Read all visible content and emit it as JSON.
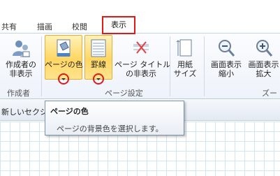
{
  "tabs": [
    {
      "label": "共有"
    },
    {
      "label": "描画"
    },
    {
      "label": "校閲"
    }
  ],
  "active_tab": {
    "label": "表示"
  },
  "ribbon": {
    "author": {
      "button_label_1": "作成者の",
      "button_label_2": "非表示",
      "group_label": "作成者"
    },
    "page_setup": {
      "page_color_label": "ページの色",
      "rule_lines_label": "罫線",
      "hide_title_label_1": "ページ タイトル",
      "hide_title_label_2": "の非表示",
      "paper_size_label_1": "用紙",
      "paper_size_label_2": "サイズ",
      "group_label": "ページ設定"
    },
    "zoom": {
      "zoom_out_label_1": "画面表示",
      "zoom_out_label_2": "縮小",
      "zoom_in_label_1": "画面表示",
      "zoom_in_label_2": "拡大",
      "group_label": "ズー"
    }
  },
  "section": {
    "text": "新しいセクシ"
  },
  "tooltip": {
    "title": "ページの色",
    "description": "ページの背景色を選択します。"
  },
  "colors": {
    "highlight_border": "#e01818",
    "button_active": "#ffd663",
    "grid_line": "#d2e6f0"
  }
}
